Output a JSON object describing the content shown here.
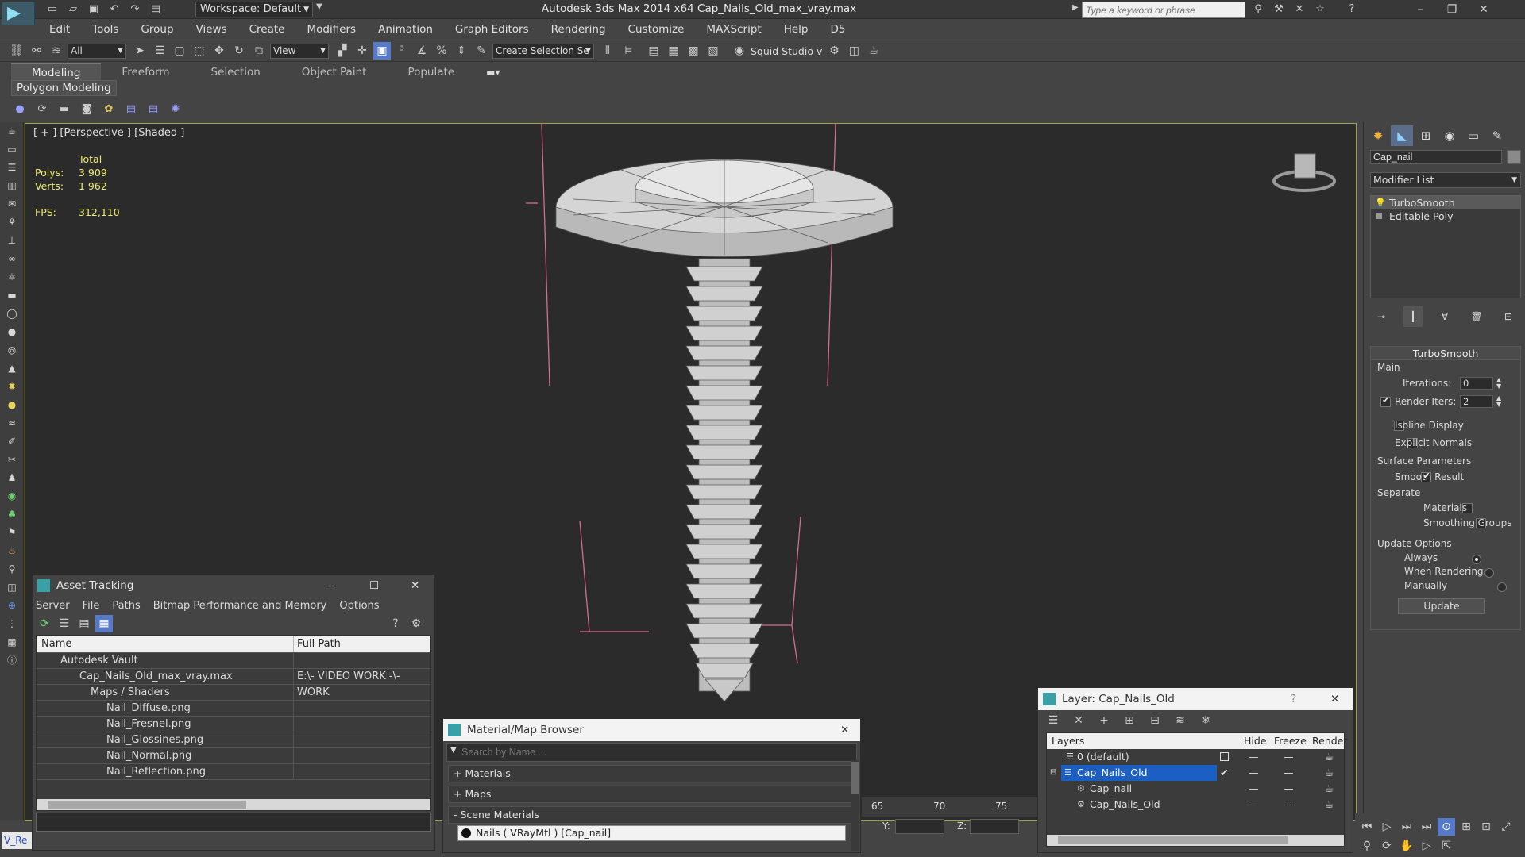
{
  "titlebar": {
    "workspace": "Workspace: Default",
    "title": "Autodesk 3ds Max  2014 x64     Cap_Nails_Old_max_vray.max",
    "search_placeholder": "Type a keyword or phrase"
  },
  "menu": [
    "Edit",
    "Tools",
    "Group",
    "Views",
    "Create",
    "Modifiers",
    "Animation",
    "Graph Editors",
    "Rendering",
    "Customize",
    "MAXScript",
    "Help",
    "D5"
  ],
  "toolbar": {
    "filter": "All",
    "refcoord": "View",
    "selection_set": "Create Selection Se",
    "squid": "Squid Studio v"
  },
  "ribbon": {
    "tabs": [
      "Modeling",
      "Freeform",
      "Selection",
      "Object Paint",
      "Populate"
    ],
    "panel_label": "Polygon Modeling"
  },
  "viewport": {
    "label": "[ + ] [Perspective ] [Shaded ]",
    "stats": {
      "total_label": "Total",
      "polys_label": "Polys:",
      "polys": "3 909",
      "verts_label": "Verts:",
      "verts": "1 962",
      "fps_label": "FPS:",
      "fps": "312,110"
    }
  },
  "command_panel": {
    "object_name": "Cap_nail",
    "modifier_list": "Modifier List",
    "stack": [
      "TurboSmooth",
      "Editable Poly"
    ],
    "rollout_title": "TurboSmooth",
    "main_label": "Main",
    "iterations_label": "Iterations:",
    "iterations": "0",
    "render_iters_label": "Render Iters:",
    "render_iters": "2",
    "isoline": "Isoline Display",
    "explicit_normals": "Explicit Normals",
    "surface_params": "Surface Parameters",
    "smooth_result": "Smooth Result",
    "separate": "Separate",
    "materials": "Materials",
    "smoothing_groups": "Smoothing Groups",
    "update_options": "Update Options",
    "always": "Always",
    "when_rendering": "When Rendering",
    "manually": "Manually",
    "update_button": "Update"
  },
  "asset_tracking": {
    "title": "Asset Tracking",
    "menu": [
      "Server",
      "File",
      "Paths",
      "Bitmap Performance and Memory",
      "Options"
    ],
    "col_name": "Name",
    "col_path": "Full Path",
    "rows": [
      {
        "name": "Autodesk Vault",
        "path": ""
      },
      {
        "name": "Cap_Nails_Old_max_vray.max",
        "path": "E:\\- VIDEO WORK -\\- WORK"
      },
      {
        "name": "Maps / Shaders",
        "path": ""
      },
      {
        "name": "Nail_Diffuse.png",
        "path": ""
      },
      {
        "name": "Nail_Fresnel.png",
        "path": ""
      },
      {
        "name": "Nail_Glossines.png",
        "path": ""
      },
      {
        "name": "Nail_Normal.png",
        "path": ""
      },
      {
        "name": "Nail_Reflection.png",
        "path": ""
      }
    ]
  },
  "material_browser": {
    "title": "Material/Map Browser",
    "search_placeholder": "Search by Name ...",
    "sections": [
      "+ Materials",
      "+ Maps",
      "- Scene Materials"
    ],
    "scene_item": "Nails  ( VRayMtl )  [Cap_nail]"
  },
  "layer_window": {
    "title": "Layer: Cap_Nails_Old",
    "help": "?",
    "col_layers": "Layers",
    "col_hide": "Hide",
    "col_freeze": "Freeze",
    "col_render": "Render",
    "rows": [
      "0 (default)",
      "Cap_Nails_Old",
      "Cap_nail",
      "Cap_Nails_Old"
    ]
  },
  "timeline": {
    "ticks": [
      "65",
      "70",
      "75"
    ],
    "y_label": "Y:",
    "z_label": "Z:"
  },
  "script_listener": "V_Re",
  "colors": {
    "viewport_bg": "#2b2b2b",
    "stats_yellow": "#ecec73",
    "selected_layer": "#1c5fc4"
  }
}
